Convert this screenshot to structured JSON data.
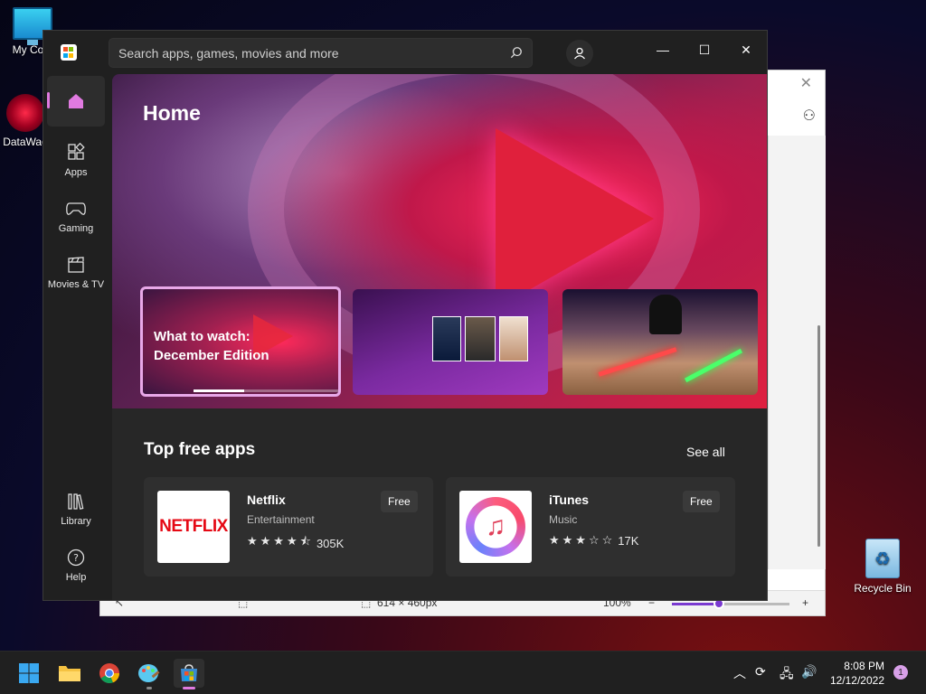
{
  "desktop": {
    "icons": [
      {
        "label": "My Com"
      },
      {
        "label": "DataWag"
      },
      {
        "label": "Recycle Bin"
      }
    ]
  },
  "background_window": {
    "status": {
      "size": "614 × 460px",
      "zoom": "100%",
      "zoom_level": 0.4
    }
  },
  "store": {
    "search": {
      "placeholder": "Search apps, games, movies and more"
    },
    "nav": {
      "home": "",
      "apps": "Apps",
      "gaming": "Gaming",
      "movies": "Movies & TV",
      "library": "Library",
      "help": "Help"
    },
    "hero": {
      "title": "Home",
      "featured": {
        "line1": "What to watch:",
        "line2": "December Edition",
        "progress": 0.35
      }
    },
    "section": {
      "title": "Top free apps",
      "see_all": "See all",
      "apps": [
        {
          "name": "Netflix",
          "category": "Entertainment",
          "rating": 4.5,
          "stars": "★★★★⯪",
          "reviews": "305K",
          "price": "Free",
          "logo_text": "NETFLIX"
        },
        {
          "name": "iTunes",
          "category": "Music",
          "rating": 3,
          "stars": "★★★☆☆",
          "reviews": "17K",
          "price": "Free"
        }
      ]
    }
  },
  "taskbar": {
    "time": "8:08 PM",
    "date": "12/12/2022",
    "notifications": "1"
  },
  "colors": {
    "accent": "#e07ae0",
    "netflix_red": "#e50914"
  }
}
